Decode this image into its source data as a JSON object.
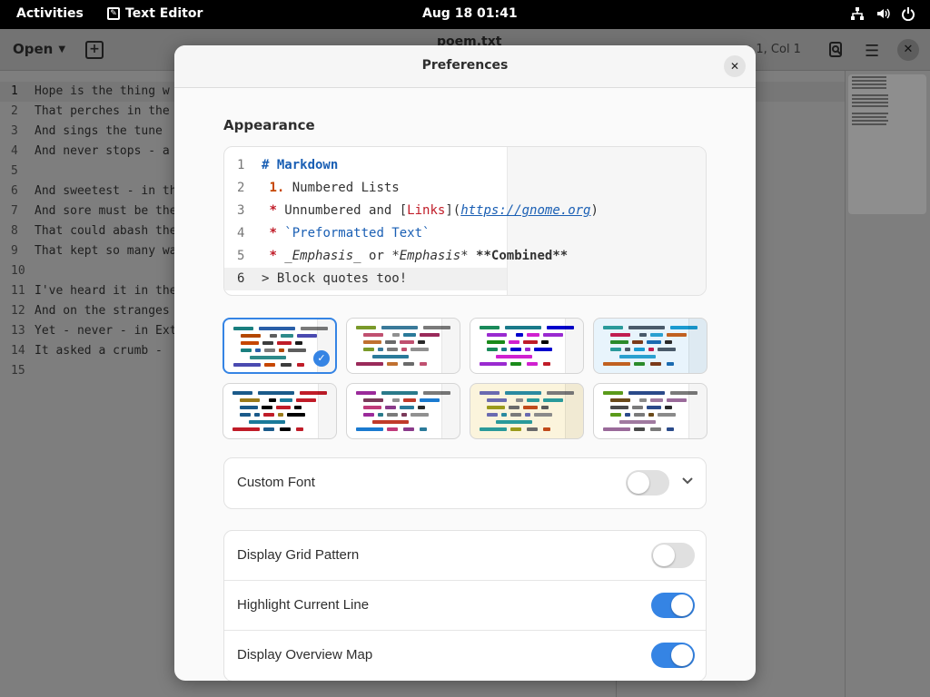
{
  "topbar": {
    "activities": "Activities",
    "app_name": "Text Editor",
    "clock": "Aug 18  01:41"
  },
  "editor": {
    "open_label": "Open",
    "file_title": "poem.txt",
    "cursor_pos": "n 1, Col  1",
    "line_numbers": [
      "1",
      "2",
      "3",
      "4",
      "5",
      "6",
      "7",
      "8",
      "9",
      "10",
      "11",
      "12",
      "13",
      "14",
      "15"
    ],
    "lines": [
      "Hope is the thing w",
      "That perches in the",
      "And sings the tune ",
      "And never stops - a",
      "",
      "And sweetest - in th",
      "And sore must be the",
      "That could abash the",
      "That kept so many wa",
      "",
      "I've heard it in the",
      "And on the stranges",
      "Yet - never - in Ext",
      "It asked a crumb - ",
      ""
    ]
  },
  "dialog": {
    "title": "Preferences",
    "group_title": "Appearance",
    "preview": {
      "line_numbers": [
        "1",
        "2",
        "3",
        "4",
        "5",
        "6"
      ],
      "l1_hash": "# Markdown",
      "l2_num": "1.",
      "l2_text": " Numbered Lists",
      "l3_star": "*",
      "l3_a": " Unnumbered and ",
      "l3_b1": "[",
      "l3_link": "Links",
      "l3_b2": "](",
      "l3_url": "https://gnome.org",
      "l3_b3": ")",
      "l4_star": "*",
      "l4_pre": " `Preformatted Text`",
      "l5_star": "*",
      "l5_em1": " _Emphasis_",
      "l5_or": " or ",
      "l5_em2": "*Emphasis*",
      "l5_sp": " ",
      "l5_b": "**Combined**",
      "l6": "> Block quotes too!"
    },
    "custom_font": {
      "label": "Custom Font",
      "on": false
    },
    "settings": [
      {
        "label": "Display Grid Pattern",
        "on": false
      },
      {
        "label": "Highlight Current Line",
        "on": true
      },
      {
        "label": "Display Overview Map",
        "on": true
      }
    ]
  },
  "colors": {
    "accent": "#3584e4",
    "scheme_backgrounds": [
      "#ffffff",
      "#ffffff",
      "#ffffff",
      "#e8f4fc",
      "#ffffff",
      "#ffffff",
      "#fbf4dc",
      "#ffffff"
    ]
  },
  "icons": {
    "app": "text-editor-icon",
    "network": "network-icon",
    "volume": "volume-icon",
    "power": "power-icon",
    "check": "checkmark-icon",
    "expand": "chevron-down-icon"
  }
}
